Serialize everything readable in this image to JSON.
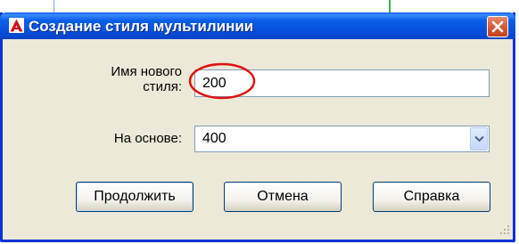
{
  "dialog": {
    "title": "Создание стиля мультилинии",
    "close_icon": "close-icon",
    "app_icon": "autocad-icon"
  },
  "form": {
    "name_label_line1": "Имя нового",
    "name_label_line2": "стиля:",
    "name_value": "200",
    "base_label": "На основе:",
    "base_value": "400"
  },
  "buttons": {
    "continue_label": "Продолжить",
    "cancel_label": "Отмена",
    "help_label": "Справка"
  },
  "colors": {
    "titlebar": "#0550dc",
    "highlight_ellipse": "#e01010"
  }
}
